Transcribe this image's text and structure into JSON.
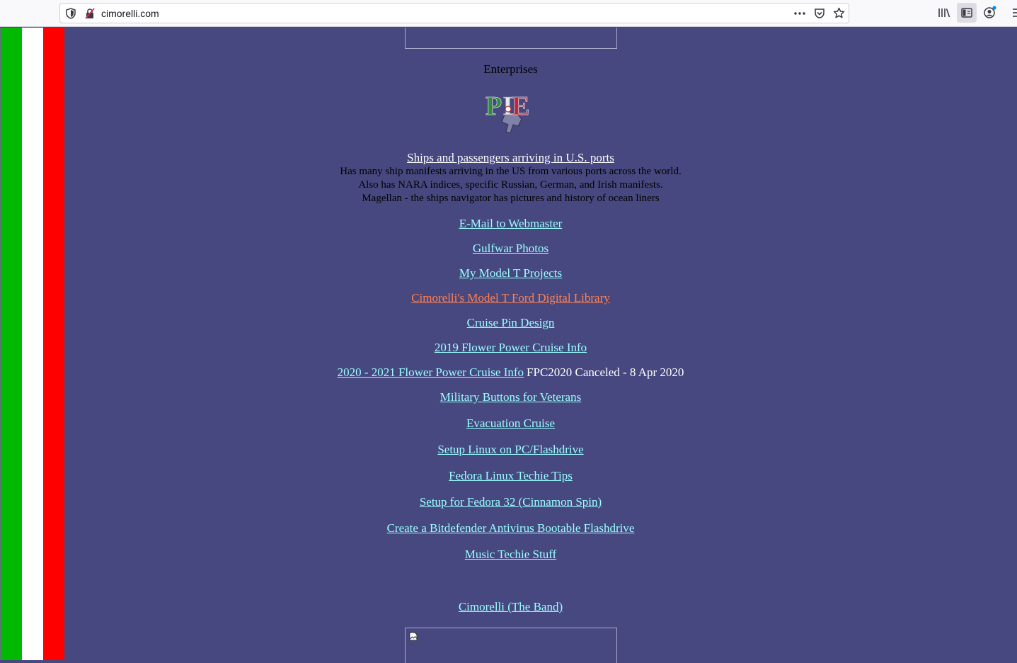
{
  "browser": {
    "url": "cimorelli.com",
    "icons": [
      "shield-icon",
      "insecure-lock-icon",
      "more-icon",
      "pocket-icon",
      "star-icon",
      "library-icon",
      "sidebar-icon",
      "account-icon",
      "menu-icon"
    ]
  },
  "colors": {
    "background": "#47487f",
    "link": "#99ffff",
    "visited_link": "#ff7f50",
    "stripe_green": "#00b900",
    "stripe_white": "#ffffff",
    "stripe_red": "#ff0000"
  },
  "page": {
    "enterprises_label": "Enterprises",
    "logo_text": "PIE",
    "ships": {
      "link": "Ships and passengers arriving in U.S. ports",
      "lines": [
        "Has many ship manifests arriving in the US from various ports across the world.",
        "Also has NARA indices, specific Russian, German, and Irish manifests.",
        "Magellan - the ships navigator has pictures and history of ocean liners"
      ]
    },
    "links": [
      "E-Mail to Webmaster",
      "Gulfwar Photos",
      "My Model T Projects",
      "Cimorelli's Model T Ford Digital Library",
      "Cruise Pin Design",
      "2019 Flower Power Cruise Info",
      "2020 - 2021 Flower Power Cruise Info",
      "Military Buttons for Veterans",
      "Evacuation Cruise",
      "Setup Linux on PC/Flashdrive",
      "Fedora Linux Techie Tips",
      "Setup for Fedora 32 (Cinnamon Spin)",
      "Create a Bitdefender Antivirus Bootable Flashdrive",
      "Music Techie Stuff",
      "Cimorelli (The Band)"
    ],
    "fpc_note": "FPC2020 Canceled - 8 Apr 2020"
  }
}
